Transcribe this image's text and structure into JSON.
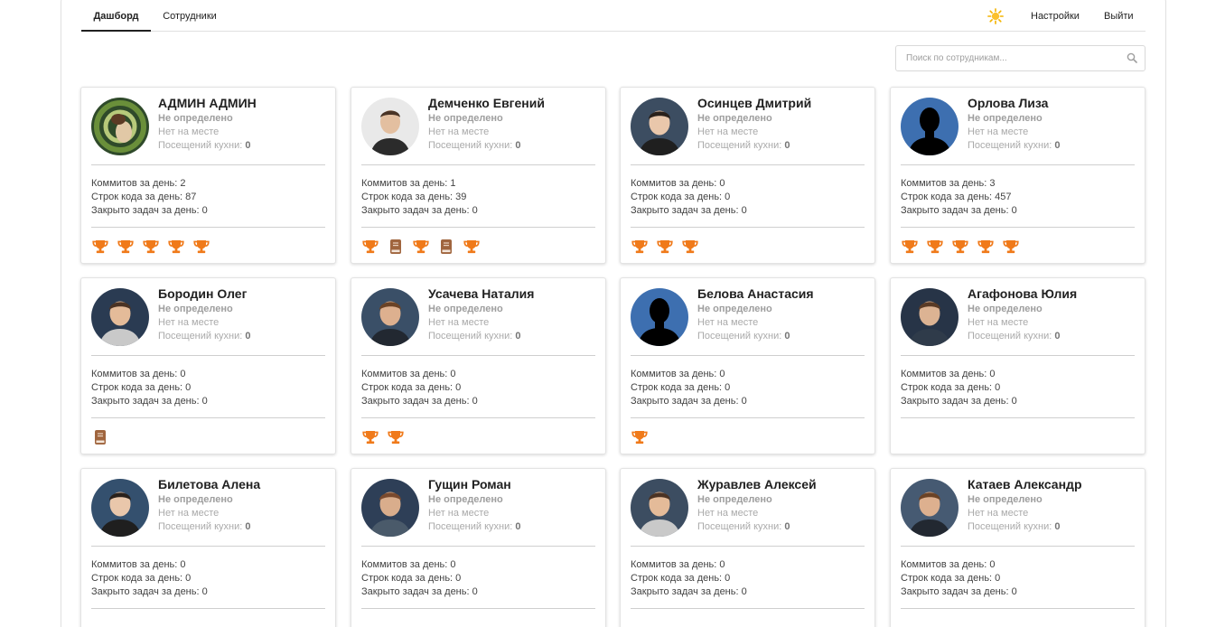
{
  "nav": {
    "tabs": [
      {
        "label": "Дашборд",
        "active": true
      },
      {
        "label": "Сотрудники",
        "active": false
      }
    ],
    "theme_icon": "sun-icon",
    "settings_label": "Настройки",
    "logout_label": "Выйти"
  },
  "search": {
    "placeholder": "Поиск по сотрудникам...",
    "value": "",
    "icon": "search-icon"
  },
  "labels": {
    "commits": "Коммитов за день: ",
    "lines": "Строк кода за день: ",
    "tasks": "Закрыто задач за день: ",
    "kitchen": "Посещений кухни: "
  },
  "colors": {
    "trophy": "#f07a1a",
    "book": "#a0653e",
    "card_border": "#e3e3e3",
    "muted_text": "#9e9e9e",
    "silhouette_bg": "#3d6fb0"
  },
  "employees": [
    {
      "name": "АДМИН АДМИН",
      "location": "Не определено",
      "presence": "Нет на месте",
      "kitchen": "0",
      "commits": "2",
      "lines": "87",
      "tasks": "0",
      "awards": [
        "trophy",
        "trophy",
        "trophy",
        "trophy",
        "trophy"
      ],
      "avatar": "photo-abstract"
    },
    {
      "name": "Демченко Евгений",
      "location": "Не определено",
      "presence": "Нет на месте",
      "kitchen": "0",
      "commits": "1",
      "lines": "39",
      "tasks": "0",
      "awards": [
        "trophy",
        "book",
        "trophy",
        "book",
        "trophy"
      ],
      "avatar": "photo-light"
    },
    {
      "name": "Осинцев Дмитрий",
      "location": "Не определено",
      "presence": "Нет на месте",
      "kitchen": "0",
      "commits": "0",
      "lines": "0",
      "tasks": "0",
      "awards": [
        "trophy",
        "trophy",
        "trophy"
      ],
      "avatar": "photo-dark"
    },
    {
      "name": "Орлова Лиза",
      "location": "Не определено",
      "presence": "Нет на месте",
      "kitchen": "0",
      "commits": "3",
      "lines": "457",
      "tasks": "0",
      "awards": [
        "trophy",
        "trophy",
        "trophy",
        "trophy",
        "trophy"
      ],
      "avatar": "silhouette"
    },
    {
      "name": "Бородин Олег",
      "location": "Не определено",
      "presence": "Нет на месте",
      "kitchen": "0",
      "commits": "0",
      "lines": "0",
      "tasks": "0",
      "awards": [
        "book"
      ],
      "avatar": "photo-dark"
    },
    {
      "name": "Усачева Наталия",
      "location": "Не определено",
      "presence": "Нет на месте",
      "kitchen": "0",
      "commits": "0",
      "lines": "0",
      "tasks": "0",
      "awards": [
        "trophy",
        "trophy"
      ],
      "avatar": "photo-dark"
    },
    {
      "name": "Белова Анастасия",
      "location": "Не определено",
      "presence": "Нет на месте",
      "kitchen": "0",
      "commits": "0",
      "lines": "0",
      "tasks": "0",
      "awards": [
        "trophy"
      ],
      "avatar": "silhouette"
    },
    {
      "name": "Агафонова Юлия",
      "location": "Не определено",
      "presence": "Нет на месте",
      "kitchen": "0",
      "commits": "0",
      "lines": "0",
      "tasks": "0",
      "awards": [],
      "avatar": "photo-dark"
    },
    {
      "name": "Билетова Алена",
      "location": "Не определено",
      "presence": "Нет на месте",
      "kitchen": "0",
      "commits": "0",
      "lines": "0",
      "tasks": "0",
      "awards": [],
      "avatar": "photo-dark"
    },
    {
      "name": "Гущин Роман",
      "location": "Не определено",
      "presence": "Нет на месте",
      "kitchen": "0",
      "commits": "0",
      "lines": "0",
      "tasks": "0",
      "awards": [],
      "avatar": "photo-dark"
    },
    {
      "name": "Журавлев Алексей",
      "location": "Не определено",
      "presence": "Нет на месте",
      "kitchen": "0",
      "commits": "0",
      "lines": "0",
      "tasks": "0",
      "awards": [],
      "avatar": "photo-dark"
    },
    {
      "name": "Катаев Александр",
      "location": "Не определено",
      "presence": "Нет на месте",
      "kitchen": "0",
      "commits": "0",
      "lines": "0",
      "tasks": "0",
      "awards": [],
      "avatar": "photo-dark"
    }
  ]
}
